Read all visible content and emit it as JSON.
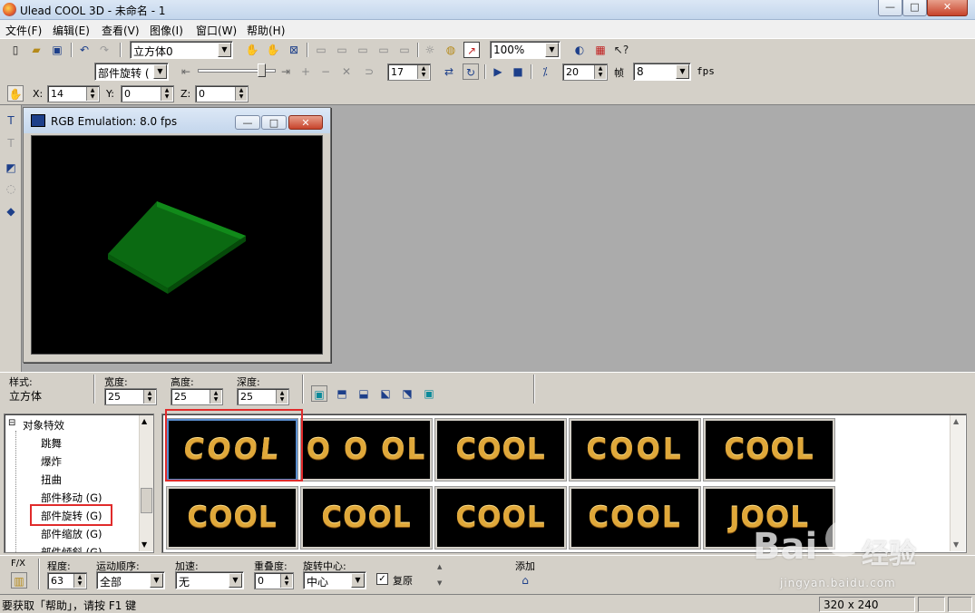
{
  "title": "Ulead COOL 3D - 未命名 - 1",
  "window_buttons": {
    "min": "—",
    "max": "□",
    "close": "✕"
  },
  "menu": [
    "文件(F)",
    "编辑(E)",
    "查看(V)",
    "图像(I)",
    "窗口(W)",
    "帮助(H)"
  ],
  "toolbar1": {
    "object_combo": "立方体0",
    "zoom_combo": "100%"
  },
  "toolbar2": {
    "effect_combo": "部件旋转 (",
    "frame_value": "17",
    "fps_value": "20",
    "frame_label": "帧",
    "frame_count_combo": "8",
    "fps_label": "fps"
  },
  "toolbar3": {
    "x_label": "X:",
    "x_value": "14",
    "y_label": "Y:",
    "y_value": "0",
    "z_label": "Z:",
    "z_value": "0"
  },
  "child_window": {
    "title": "RGB Emulation: 8.0 fps"
  },
  "props": {
    "style_label": "样式:",
    "style_value": "立方体",
    "width_label": "宽度:",
    "width_value": "25",
    "height_label": "高度:",
    "height_value": "25",
    "depth_label": "深度:",
    "depth_value": "25"
  },
  "tree": {
    "root": "对象特效",
    "expander": "⊟",
    "items": [
      "跳舞",
      "爆炸",
      "扭曲",
      "部件移动 (G)",
      "部件旋转 (G)",
      "部件缩放 (G)",
      "部件倾斜 (G)"
    ]
  },
  "thumbnails": [
    {
      "text": "COOL",
      "variant": "warped"
    },
    {
      "text": "O O OL",
      "variant": "spread"
    },
    {
      "text": "COOL",
      "variant": "tilt"
    },
    {
      "text": "COOL",
      "variant": "bold"
    },
    {
      "text": "COOL",
      "variant": "plain"
    },
    {
      "text": "COOL",
      "variant": "plain"
    },
    {
      "text": "COOL",
      "variant": "plain"
    },
    {
      "text": "COOL",
      "variant": "plain"
    },
    {
      "text": "COOL",
      "variant": "curl"
    },
    {
      "text": "JOOL",
      "variant": "flip"
    }
  ],
  "bottom": {
    "fx_label": "F/X",
    "degree_label": "程度:",
    "degree_value": "63",
    "order_label": "运动顺序:",
    "order_value": "全部",
    "accel_label": "加速:",
    "accel_value": "无",
    "overlap_label": "重叠度:",
    "overlap_value": "0",
    "center_label": "旋转中心:",
    "center_value": "中心",
    "restore_label": "复原",
    "restore_checked": "✓",
    "add_label": "添加"
  },
  "status": {
    "help": "要获取「帮助」，请按 F1 键",
    "size": "320 x 240"
  },
  "watermark": {
    "brand": "Bai",
    "brand2": "经验",
    "url": "jingyan.baidu.com"
  },
  "colors": {
    "accent_red": "#e02b2b",
    "gold": "#e0a83a",
    "green": "#0b6a12"
  }
}
